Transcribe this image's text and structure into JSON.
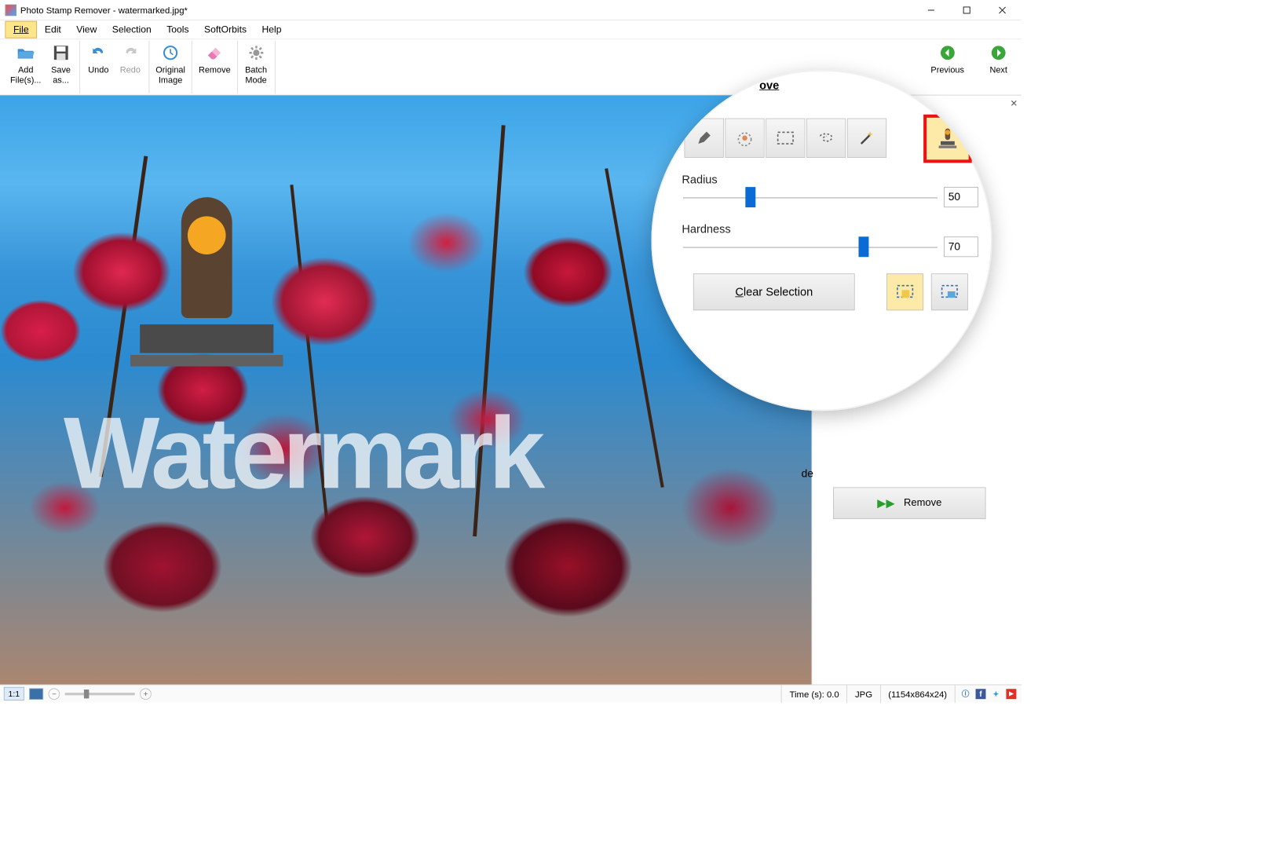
{
  "title": "Photo Stamp Remover - watermarked.jpg*",
  "menus": {
    "file": "File",
    "edit": "Edit",
    "view": "View",
    "selection": "Selection",
    "tools": "Tools",
    "softorbits": "SoftOrbits",
    "help": "Help"
  },
  "toolbar": {
    "add": "Add\nFile(s)...",
    "save": "Save\nas...",
    "undo": "Undo",
    "redo": "Redo",
    "original": "Original\nImage",
    "remove": "Remove",
    "batch": "Batch\nMode",
    "previous": "Previous",
    "next": "Next"
  },
  "canvas": {
    "watermark_text": "Watermark"
  },
  "panel": {
    "title_partial": "ove",
    "radius_label": "Radius",
    "radius_value": "50",
    "hardness_label": "Hardness",
    "hardness_value": "70",
    "clear_selection": "Clear Selection",
    "mode_label": "de",
    "remove": "Remove"
  },
  "status": {
    "ratio": "1:1",
    "time": "Time (s): 0.0",
    "format": "JPG",
    "dims": "(1154x864x24)"
  }
}
